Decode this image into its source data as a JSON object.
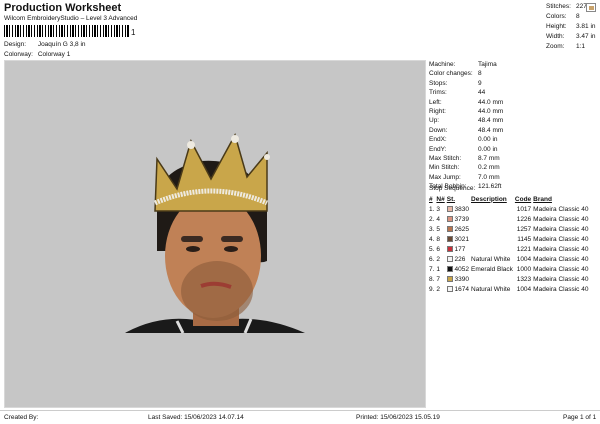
{
  "header": {
    "title": "Production Worksheet",
    "subtitle": "Wilcom EmbroideryStudio – Level 3 Advanced",
    "barcode_suffix": "1",
    "design_label": "Design:",
    "design_value": "Joaquín G 3,8 in",
    "colorway_label": "Colorway:",
    "colorway_value": "Colorway 1"
  },
  "stats": [
    {
      "k": "Stitches:",
      "v": "22736"
    },
    {
      "k": "Colors:",
      "v": "8"
    },
    {
      "k": "Height:",
      "v": "3.81 in"
    },
    {
      "k": "Width:",
      "v": "3.47 in"
    },
    {
      "k": "Zoom:",
      "v": "1:1"
    }
  ],
  "machine_info": [
    {
      "k": "Machine:",
      "v": "Tajima"
    },
    {
      "k": "Color changes:",
      "v": "8"
    },
    {
      "k": "Stops:",
      "v": "9"
    },
    {
      "k": "Trims:",
      "v": "44"
    },
    {
      "k": "Left:",
      "v": "44.0 mm"
    },
    {
      "k": "Right:",
      "v": "44.0 mm"
    },
    {
      "k": "Up:",
      "v": "48.4 mm"
    },
    {
      "k": "Down:",
      "v": "48.4 mm"
    },
    {
      "k": "EndX:",
      "v": "0.00 in"
    },
    {
      "k": "EndY:",
      "v": "0.00 in"
    },
    {
      "k": "Max Stitch:",
      "v": "8.7 mm"
    },
    {
      "k": "Min Stitch:",
      "v": "0.2 mm"
    },
    {
      "k": "Max Jump:",
      "v": "7.0 mm"
    },
    {
      "k": "Total Bobbin:",
      "v": "121.62ft"
    }
  ],
  "stop_sequence": {
    "title": "Stop Sequence:",
    "headers": [
      "#",
      "N#",
      "St.",
      "Description",
      "Code",
      "Brand"
    ],
    "rows": [
      {
        "n": "1.",
        "nn": "3",
        "color": "#e7b7a6",
        "code_th": "3830",
        "desc": "",
        "st": "1017",
        "brand": "Madeira Classic 40"
      },
      {
        "n": "2.",
        "nn": "4",
        "color": "#d9927e",
        "code_th": "3739",
        "desc": "",
        "st": "1226",
        "brand": "Madeira Classic 40"
      },
      {
        "n": "3.",
        "nn": "5",
        "color": "#b8744e",
        "code_th": "2625",
        "desc": "",
        "st": "1257",
        "brand": "Madeira Classic 40"
      },
      {
        "n": "4.",
        "nn": "8",
        "color": "#6b4a34",
        "code_th": "3021",
        "desc": "",
        "st": "1145",
        "brand": "Madeira Classic 40"
      },
      {
        "n": "5.",
        "nn": "6",
        "color": "#c9303a",
        "code_th": "177",
        "desc": "",
        "st": "1221",
        "brand": "Madeira Classic 40"
      },
      {
        "n": "6.",
        "nn": "2",
        "color": "#f4f4f4",
        "code_th": "226",
        "desc": "Natural White",
        "st": "1004",
        "brand": "Madeira Classic 40"
      },
      {
        "n": "7.",
        "nn": "1",
        "color": "#111111",
        "code_th": "4052",
        "desc": "Emerald Black",
        "st": "1000",
        "brand": "Madeira Classic 40"
      },
      {
        "n": "8.",
        "nn": "7",
        "color": "#c9a64a",
        "code_th": "3390",
        "desc": "",
        "st": "1323",
        "brand": "Madeira Classic 40"
      },
      {
        "n": "9.",
        "nn": "2",
        "color": "#f4f4f4",
        "code_th": "1674",
        "desc": "Natural White",
        "st": "1004",
        "brand": "Madeira Classic 40"
      }
    ]
  },
  "footer": {
    "created": "Created By:",
    "saved": "Last Saved: 15/06/2023 14.07.14",
    "printed": "Printed: 15/06/2023 15.05.19",
    "page": "Page 1 of 1"
  }
}
